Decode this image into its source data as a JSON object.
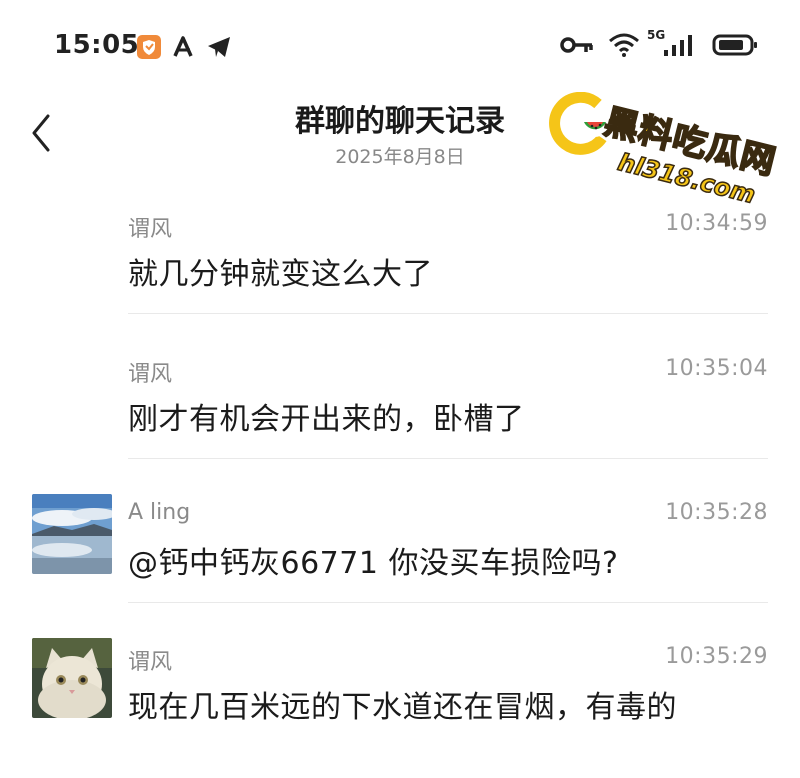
{
  "status_bar": {
    "time": "15:05",
    "network": "5G",
    "icons_left": [
      "shield-app-icon",
      "a-notification-icon",
      "telegram-icon"
    ],
    "icons_right": [
      "key-icon",
      "wifi-icon",
      "signal-icon",
      "battery-icon"
    ]
  },
  "header": {
    "title": "群聊的聊天记录",
    "subtitle": "2025年8月8日"
  },
  "watermark": {
    "text": "黑料吃瓜网",
    "url": "hl318.com"
  },
  "messages": [
    {
      "sender": "谓风",
      "time": "10:34:59",
      "text": "就几分钟就变这么大了",
      "avatar": "none"
    },
    {
      "sender": "谓风",
      "time": "10:35:04",
      "text": "刚才有机会开出来的，卧槽了",
      "avatar": "none"
    },
    {
      "sender": "A ling",
      "time": "10:35:28",
      "text": "@钙中钙灰66771 你没买车损险吗?",
      "avatar": "lake-landscape"
    },
    {
      "sender": "谓风",
      "time": "10:35:29",
      "text": "现在几百米远的下水道还在冒烟，有毒的",
      "avatar": "cat"
    }
  ],
  "colors": {
    "title": "#1a1a1a",
    "subtitle": "#888888",
    "sender": "#8a8a8a",
    "time": "#9a9a9a",
    "divider": "#e9e9e9",
    "watermark_yellow": "#f5c518"
  }
}
